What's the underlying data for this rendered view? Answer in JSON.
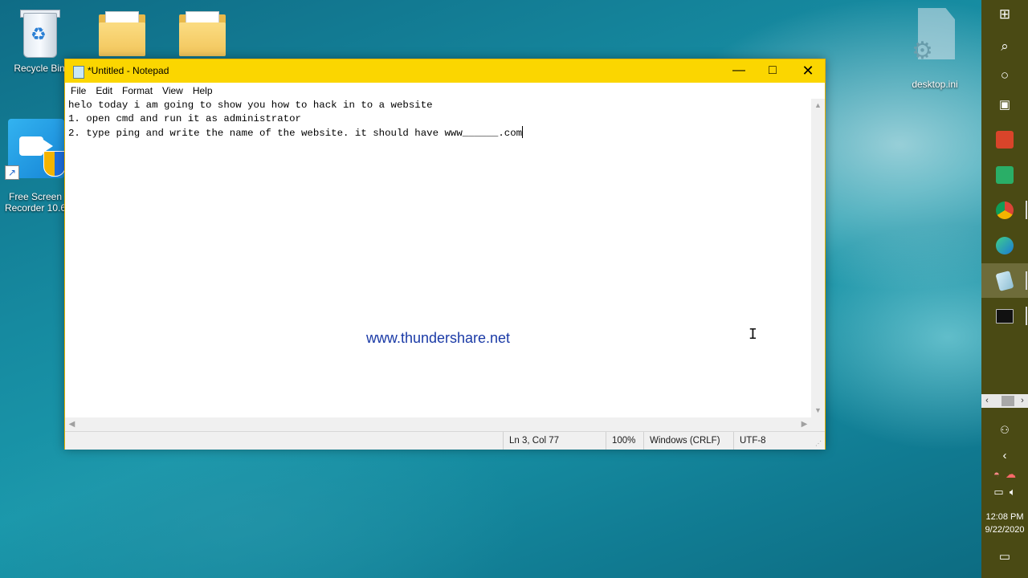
{
  "desktop": {
    "icons": [
      {
        "label": "Recycle Bin"
      },
      {
        "label": ""
      },
      {
        "label": ""
      },
      {
        "label": "Free Screen Recorder 10.6"
      },
      {
        "label": "desktop.ini"
      }
    ]
  },
  "notepad": {
    "title": "*Untitled - Notepad",
    "menu": [
      "File",
      "Edit",
      "Format",
      "View",
      "Help"
    ],
    "content_lines": [
      "helo today i am going to show you how to hack in to a website",
      "1. open cmd and run it as administrator",
      "2. type ping and write the name of the website. it should have www______.com"
    ],
    "status": {
      "position": "Ln 3, Col 77",
      "zoom": "100%",
      "line_ending": "Windows (CRLF)",
      "encoding": "UTF-8"
    },
    "watermark": "www.thundershare.net",
    "accent_color": "#fbd600"
  },
  "taskbar": {
    "color": "#4a4a14",
    "clock_time": "12:08 PM",
    "clock_date": "9/22/2020",
    "icons": [
      "windows-start-icon",
      "search-icon",
      "cortana-icon",
      "task-view-icon",
      "powerpoint-icon",
      "wechat-icon",
      "chrome-icon",
      "edge-icon",
      "notepad-icon",
      "cmd-icon"
    ]
  }
}
